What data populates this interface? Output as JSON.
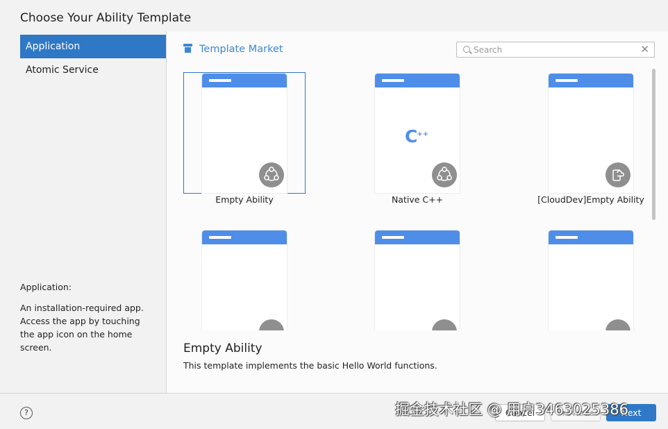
{
  "dialog": {
    "title": "Choose Your Ability Template"
  },
  "sidebar": {
    "items": [
      {
        "label": "Application",
        "selected": true
      },
      {
        "label": "Atomic Service",
        "selected": false
      }
    ],
    "description_title": "Application:",
    "description": "An installation-required app. Access the app by touching the app icon on the home screen."
  },
  "market": {
    "label": "Template Market"
  },
  "search": {
    "placeholder": "Search",
    "value": "",
    "clear_icon": "close-icon"
  },
  "templates": [
    {
      "label": "Empty Ability",
      "icon": "ability-share-icon",
      "selected": true
    },
    {
      "label": "Native C++",
      "icon": "ability-share-icon",
      "selected": false
    },
    {
      "label": "[CloudDev]Empty Ability",
      "icon": "cloud-device-icon",
      "selected": false
    },
    {
      "label": "",
      "icon": "partial-icon",
      "selected": false
    },
    {
      "label": "",
      "icon": "partial-icon",
      "selected": false
    },
    {
      "label": "",
      "icon": "partial-icon",
      "selected": false
    }
  ],
  "selected_template": {
    "title": "Empty Ability",
    "description": "This template implements the basic Hello World functions."
  },
  "footer": {
    "help": "?",
    "cancel": "Cancel",
    "previous": "Previous",
    "next": "Next"
  },
  "watermark": "掘金技术社区 @ 用户3463025386",
  "colors": {
    "accent": "#2f78c6",
    "phone_bar": "#4f8ee8",
    "link": "#3d87d3"
  }
}
